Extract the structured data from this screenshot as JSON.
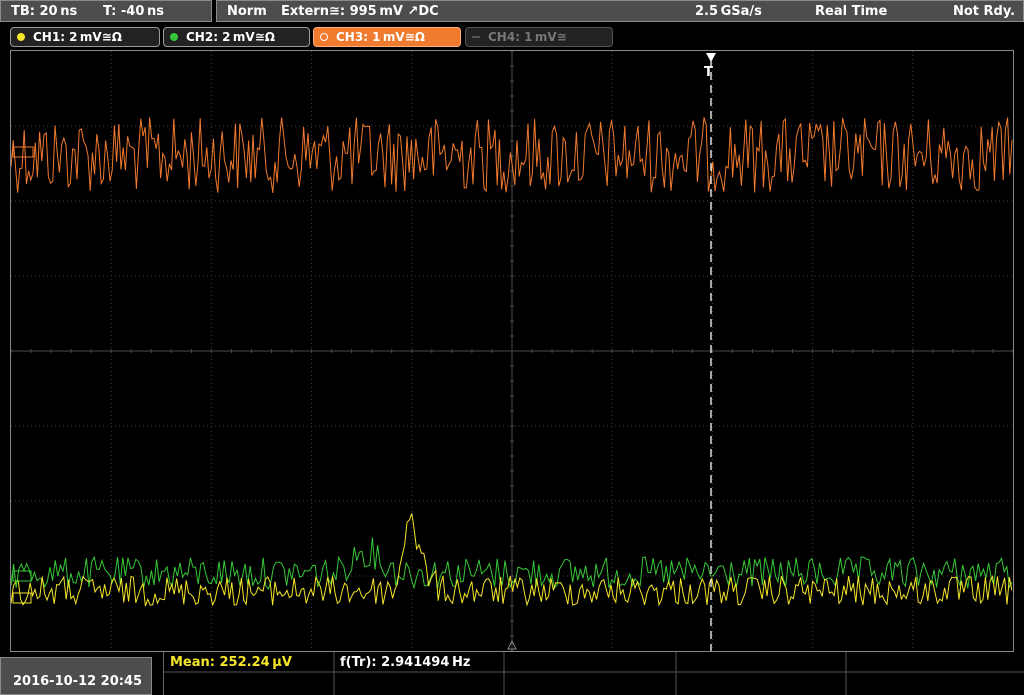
{
  "topbar": {
    "timebase": "TB: 20 ns",
    "trigger_time": "T: -40 ns",
    "mode": "Norm",
    "trigger_source": "Extern≅: 995 mV ↗DC",
    "sample_rate": "2.5 GSa/s",
    "acquisition": "Real Time",
    "state": "Not Rdy."
  },
  "channels": [
    {
      "label": "CH1: 2 mV≅Ω",
      "color": "#f5e62a"
    },
    {
      "label": "CH2: 2 mV≅Ω",
      "color": "#37c837"
    },
    {
      "label": "CH3: 1 mV≅Ω",
      "color": "#f07a2e"
    },
    {
      "label": "CH4: 1 mV≅",
      "color": "#6a6a6a"
    }
  ],
  "trigger_marker": "T",
  "bottombar": {
    "datetime": "2016-10-12 20:45",
    "mean": "Mean: 252.24 µV",
    "freq": "f(Tr): 2.941494 Hz"
  },
  "colors": {
    "ch1": "#f5e62a",
    "ch2": "#37c837",
    "ch3": "#f07a2e",
    "grid": "#3a3a3a",
    "panel": "#4d4d4d"
  }
}
